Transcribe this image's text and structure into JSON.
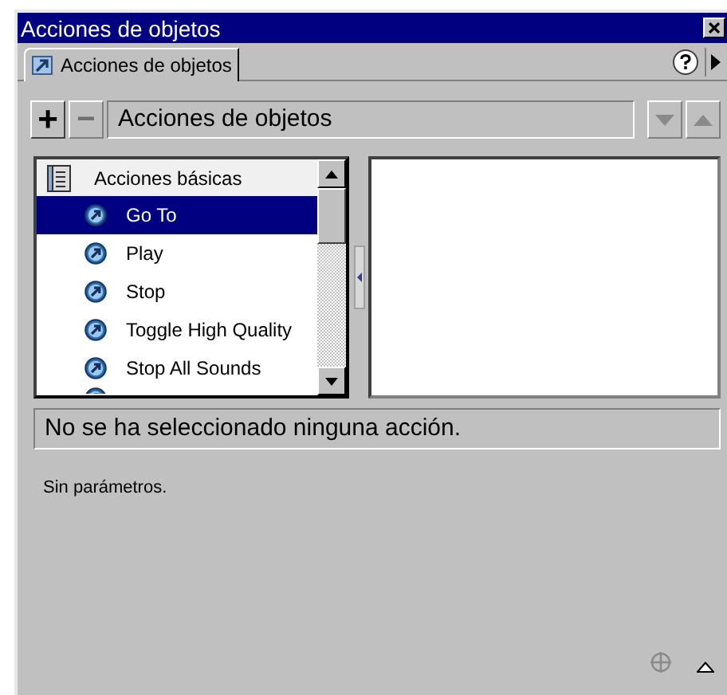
{
  "window": {
    "title": "Acciones de objetos"
  },
  "tabs": [
    {
      "label": "Acciones de objetos",
      "selected": true
    }
  ],
  "toolbar": {
    "add": "+",
    "remove": "−",
    "path": "Acciones de objetos",
    "remove_disabled": true
  },
  "action_list": {
    "category": "Acciones básicas",
    "items": [
      {
        "label": "Go To",
        "selected": true
      },
      {
        "label": "Play",
        "selected": false
      },
      {
        "label": "Stop",
        "selected": false
      },
      {
        "label": "Toggle High Quality",
        "selected": false
      },
      {
        "label": "Stop All Sounds",
        "selected": false
      }
    ]
  },
  "message": "No se ha seleccionado ninguna acción.",
  "parameters": "Sin parámetros."
}
